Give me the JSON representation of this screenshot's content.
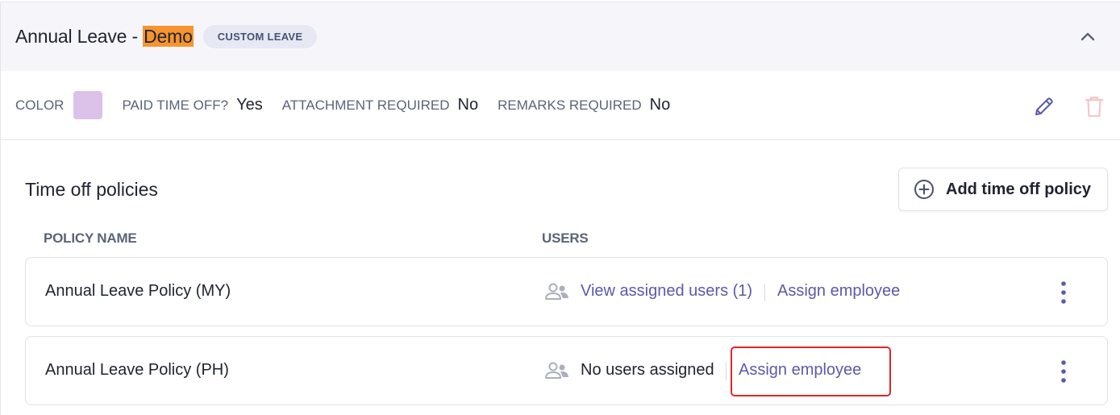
{
  "header": {
    "title_prefix": "Annual Leave - ",
    "title_highlight": "Demo",
    "badge": "CUSTOM LEAVE"
  },
  "properties": {
    "color_label": "COLOR",
    "color_value": "#dcc1e8",
    "paid_label": "PAID TIME OFF?",
    "paid_value": "Yes",
    "attachment_label": "ATTACHMENT REQUIRED",
    "attachment_value": "No",
    "remarks_label": "REMARKS REQUIRED",
    "remarks_value": "No"
  },
  "section": {
    "title": "Time off policies",
    "add_button": "Add time off policy"
  },
  "columns": {
    "policy_name": "POLICY NAME",
    "users": "USERS"
  },
  "rows": [
    {
      "name": "Annual Leave Policy (MY)",
      "users_text": "View assigned users (1)",
      "assign": "Assign employee"
    },
    {
      "name": "Annual Leave Policy (PH)",
      "users_text": "No users assigned",
      "assign": "Assign employee"
    }
  ],
  "icons": {
    "collapse": "chevron-up-icon",
    "edit": "pencil-icon",
    "delete": "trash-icon",
    "add": "plus-circle-icon",
    "users": "users-icon",
    "menu": "kebab-menu-icon"
  },
  "colors": {
    "accent": "#5b5aa8",
    "highlight": "#f7942f",
    "badge_bg": "#e6e8f4",
    "annotation": "#e0262b"
  }
}
